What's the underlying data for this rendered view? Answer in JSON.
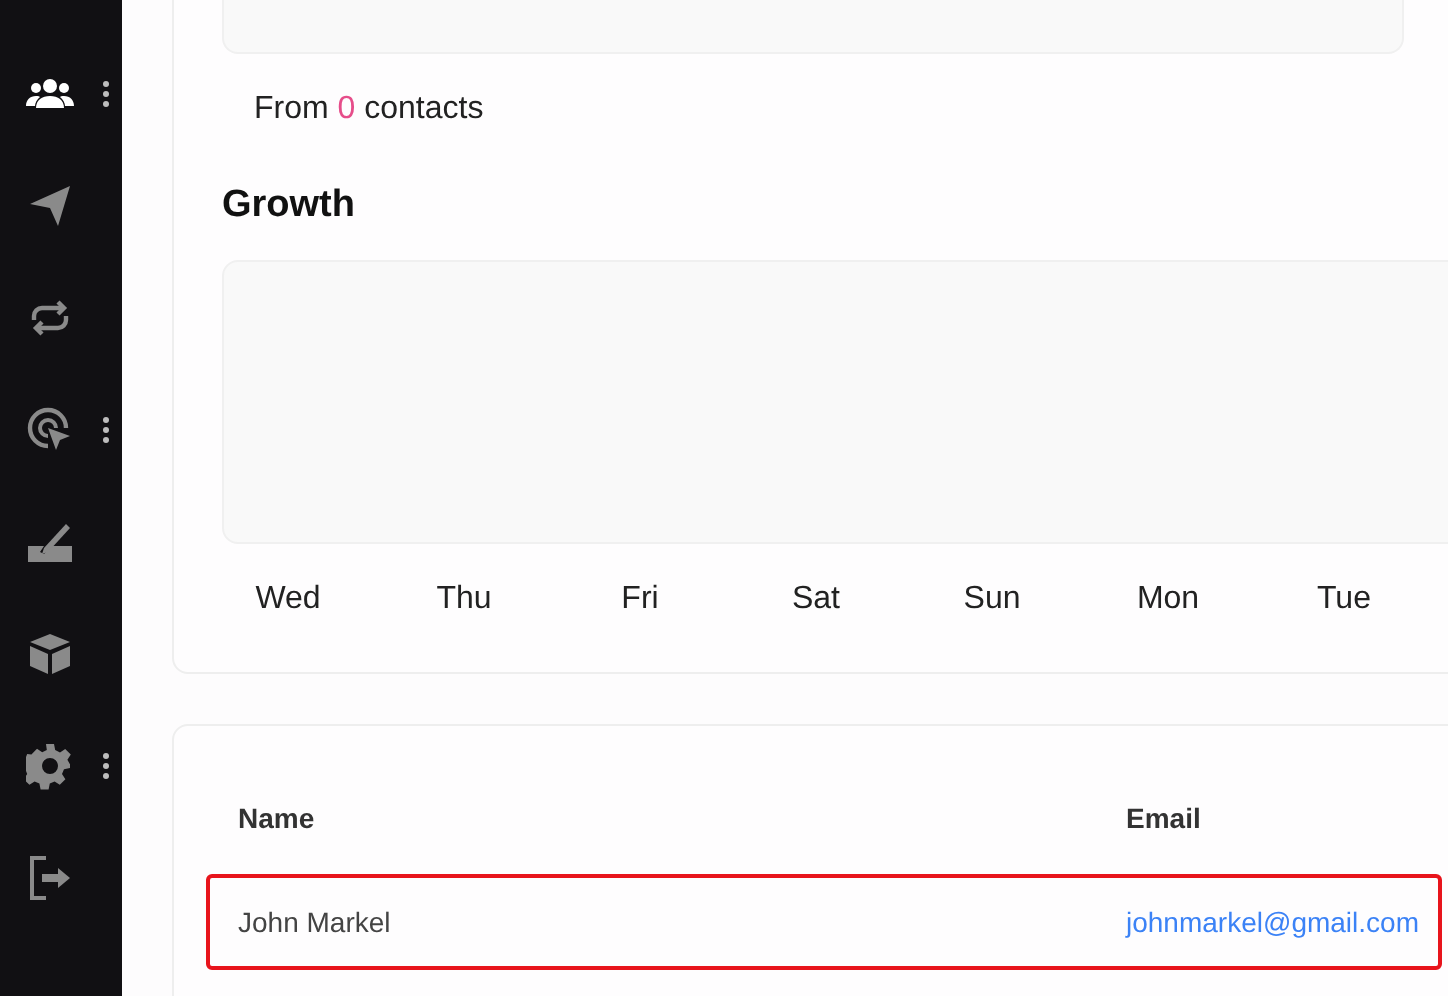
{
  "sidebar": {
    "items": [
      {
        "selected": true,
        "has_menu": true
      },
      {
        "selected": false,
        "has_menu": false
      },
      {
        "selected": false,
        "has_menu": false
      },
      {
        "selected": false,
        "has_menu": true
      },
      {
        "selected": false,
        "has_menu": false
      },
      {
        "selected": false,
        "has_menu": false
      },
      {
        "selected": false,
        "has_menu": true
      },
      {
        "selected": false,
        "has_menu": false
      }
    ]
  },
  "summary": {
    "prefix": "From",
    "count": "0",
    "suffix": "contacts"
  },
  "growth": {
    "title": "Growth",
    "days": [
      "Wed",
      "Thu",
      "Fri",
      "Sat",
      "Sun",
      "Mon",
      "Tue"
    ]
  },
  "table": {
    "columns": [
      "Name",
      "Email"
    ],
    "rows": [
      {
        "name": "John Markel",
        "email": "johnmarkel@gmail.com",
        "highlighted": true
      }
    ]
  }
}
